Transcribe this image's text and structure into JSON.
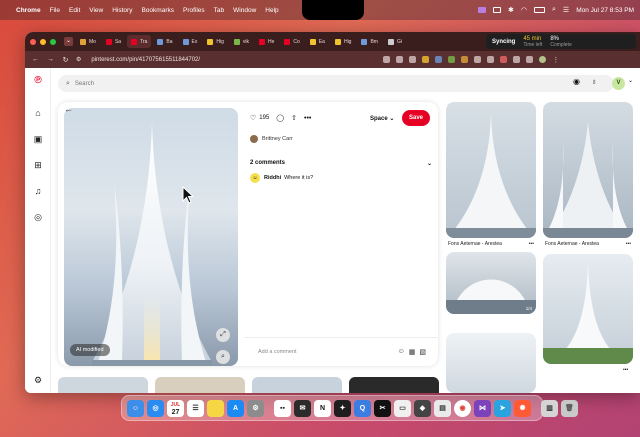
{
  "menubar": {
    "app": "Chrome",
    "items": [
      "File",
      "Edit",
      "View",
      "History",
      "Bookmarks",
      "Profiles",
      "Tab",
      "Window",
      "Help"
    ],
    "datetime": "Mon Jul 27  8:53 PM"
  },
  "browser": {
    "tabs": [
      {
        "label": "Mo",
        "color": "#e0a33a"
      },
      {
        "label": "Sa",
        "color": "#e60023"
      },
      {
        "label": "Tra",
        "color": "#e60023"
      },
      {
        "label": "Ba",
        "color": "#6f9ad8"
      },
      {
        "label": "Ex",
        "color": "#6f9ad8"
      },
      {
        "label": "Hig",
        "color": "#f2c230"
      },
      {
        "label": "vik",
        "color": "#7ab648"
      },
      {
        "label": "He",
        "color": "#e60023"
      },
      {
        "label": "Co",
        "color": "#e60023"
      },
      {
        "label": "Ea",
        "color": "#f2c230"
      },
      {
        "label": "Hig",
        "color": "#f2c230"
      },
      {
        "label": "Bm",
        "color": "#6f9ad8"
      },
      {
        "label": "Gi",
        "color": "#cccccc"
      }
    ],
    "syncing": {
      "label": "Syncing",
      "time": "45 min",
      "time_sub": "Time left",
      "percent": "8%",
      "percent_sub": "Complete"
    },
    "url": "pinterest.com/pin/417075615511844702/"
  },
  "page": {
    "search_placeholder": "Search",
    "avatar_letter": "V",
    "pin": {
      "ai_badge": "AI modified",
      "like_count": "195",
      "board_dropdown": "Space",
      "save_label": "Save",
      "author": "Brittney Carr",
      "comments_header": "2 comments",
      "comment_user": "Riddhi",
      "comment_text": "Where it is?",
      "add_comment_placeholder": "Add a comment"
    },
    "related": [
      {
        "caption": "Fons Aeternae - Arestea"
      },
      {
        "caption": "Fons Aeternae - Arestea"
      }
    ],
    "related_tag": "1/4"
  },
  "dock": {
    "apps": [
      "finder-icon",
      "safari-icon",
      "calendar-icon",
      "reminders-icon",
      "notes-icon",
      "appstore-icon",
      "settings-icon",
      "dice-icon",
      "mail-icon",
      "notion-icon",
      "figma-icon",
      "quicktime-icon",
      "capcut-icon",
      "screen-icon",
      "sandbox-icon",
      "chrome-icon",
      "visualstudio-icon",
      "telegram-icon",
      "spark-icon",
      "manager-icon",
      "trash-icon"
    ],
    "calendar_day": "27",
    "calendar_month": "JUL"
  },
  "colors": {
    "pinterest_red": "#e60023",
    "chrome_tab_bar": "#3a1d1d",
    "chrome_addr_bar": "#5a2f2f"
  }
}
